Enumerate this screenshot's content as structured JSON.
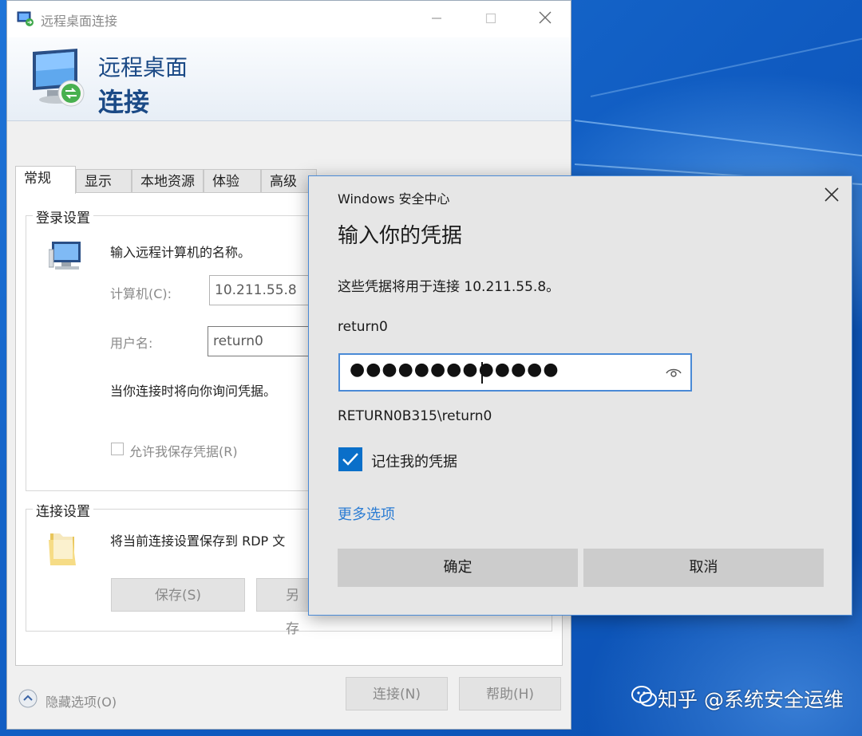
{
  "rdp_window": {
    "title": "远程桌面连接",
    "banner_line1": "远程桌面",
    "banner_line2": "连接",
    "tabs": [
      {
        "label": "常规",
        "active": true
      },
      {
        "label": "显示",
        "active": false
      },
      {
        "label": "本地资源",
        "active": false
      },
      {
        "label": "体验",
        "active": false
      },
      {
        "label": "高级",
        "active": false
      }
    ],
    "login_group": {
      "legend": "登录设置",
      "instruction": "输入远程计算机的名称。",
      "computer_label": "计算机(C):",
      "computer_value": "10.211.55.8",
      "username_label": "用户名:",
      "username_value": "return0",
      "prompt_text": "当你连接时将向你询问凭据。",
      "save_credentials_label": "允许我保存凭据(R)"
    },
    "connect_group": {
      "legend": "连接设置",
      "text": "将当前连接设置保存到 RDP 文",
      "save_button": "保存(S)",
      "saveas_button": "另存"
    },
    "hide_options_label": "隐藏选项(O)",
    "connect_button": "连接(N)",
    "help_button": "帮助(H)"
  },
  "credential_dialog": {
    "title": "Windows 安全中心",
    "heading": "输入你的凭据",
    "description": "这些凭据将用于连接 10.211.55.8。",
    "username": "return0",
    "password_masked": "●●●●●●●●●●●●●",
    "domain_user": "RETURN0B315\\return0",
    "remember_label": "记住我的凭据",
    "remember_checked": true,
    "more_options": "更多选项",
    "ok_button": "确定",
    "cancel_button": "取消",
    "accent_color": "#0a6fc9",
    "link_color": "#2b7cd3"
  },
  "watermark": "知乎 @系统安全运维"
}
